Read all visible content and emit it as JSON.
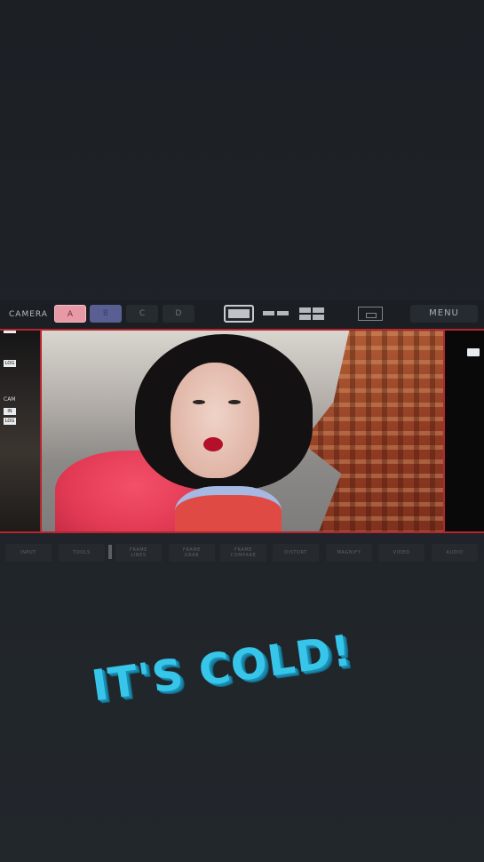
{
  "topbar": {
    "camera_label": "CAMERA",
    "cameras": [
      {
        "label": "A",
        "state": "active",
        "color": "#e79aa6"
      },
      {
        "label": "B",
        "state": "secondary",
        "color": "#5a5f93"
      },
      {
        "label": "C",
        "state": "inactive"
      },
      {
        "label": "D",
        "state": "inactive"
      }
    ],
    "layouts": [
      "single-view-icon",
      "dual-view-icon",
      "quad-view-icon"
    ],
    "pip_icon": "picture-in-picture-icon",
    "menu_label": "MENU"
  },
  "viewer": {
    "border_color": "#b5262e",
    "left_panel": {
      "tag_top": "",
      "tag_mid": "LOG",
      "cam_text": "CAM",
      "tag_in": "IN",
      "tag_bottom": "LOG"
    },
    "right_panel_icon": "cycle-icon"
  },
  "toolbar": {
    "tools": [
      {
        "label": "INPUT"
      },
      {
        "label": "TOOLS"
      },
      {
        "label": "FRAME\nLINES"
      },
      {
        "label": "FRAME\nGRAB"
      },
      {
        "label": "FRAME\nCOMPARE"
      },
      {
        "label": "DISTORT"
      },
      {
        "label": "MAGNIFY"
      },
      {
        "label": "VIDEO"
      },
      {
        "label": "AUDIO"
      }
    ]
  },
  "sticker": {
    "text": "IT'S COLD!",
    "color": "#37c6ea"
  }
}
